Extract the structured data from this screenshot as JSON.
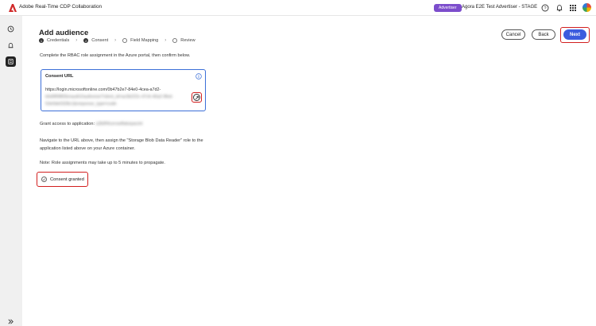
{
  "header": {
    "app_title": "Adobe Real-Time CDP Collaboration",
    "advertiser_badge": "Advertiser",
    "advertiser_name": "Agora E2E Test Advertiser - STAGE"
  },
  "page": {
    "title": "Add audience",
    "steps": [
      {
        "number": "1",
        "label": "Credentials",
        "state": "complete"
      },
      {
        "number": "2",
        "label": "Consent",
        "state": "current"
      },
      {
        "number": "",
        "label": "Field Mapping",
        "state": "pending"
      },
      {
        "number": "",
        "label": "Review",
        "state": "pending"
      }
    ],
    "buttons": {
      "cancel": "Cancel",
      "back": "Back",
      "next": "Next"
    },
    "instruction": "Complete the RBAC role assignment in the Azure portal, then confirm below.",
    "consent_card": {
      "label": "Consent URL",
      "url_visible": "https://login.microsoftonline.com/0b47b2e7-84e0-4cea-a7d2-",
      "url_blurred_line2": "b6d9f5f8f2b/oauth2/authorize?client_id=ac0b222c-47c6-40a2-9fed-",
      "url_blurred_line3": "53e0de0328c1&response_type=code"
    },
    "grant_access_label": "Grant access to application:",
    "grant_access_app_blurred": "a3b9f4cerowflakepacint",
    "navigate_text_line1": "Navigate to the URL above, then assign the \"Storage Blob Data Reader\" role to the",
    "navigate_text_line2": "application listed above on your Azure container.",
    "note_text": "Note: Role assignments may take up to 5 minutes to propagate.",
    "consent_checkbox_label": "Consent granted",
    "consent_checked": false
  },
  "colors": {
    "accent": "#3b5cde",
    "advertiser_badge": "#7c4dcc",
    "highlight": "#d21f1f",
    "card_border": "#3b6fd8"
  },
  "icons": {
    "logo": "adobe-logo-icon",
    "help": "help-icon",
    "bell": "bell-icon",
    "apps": "apps-grid-icon",
    "rail": [
      "history-icon",
      "notifications-icon",
      "data-sources-icon",
      "expand-icon"
    ],
    "info": "info-icon",
    "copy": "open-link-icon"
  }
}
